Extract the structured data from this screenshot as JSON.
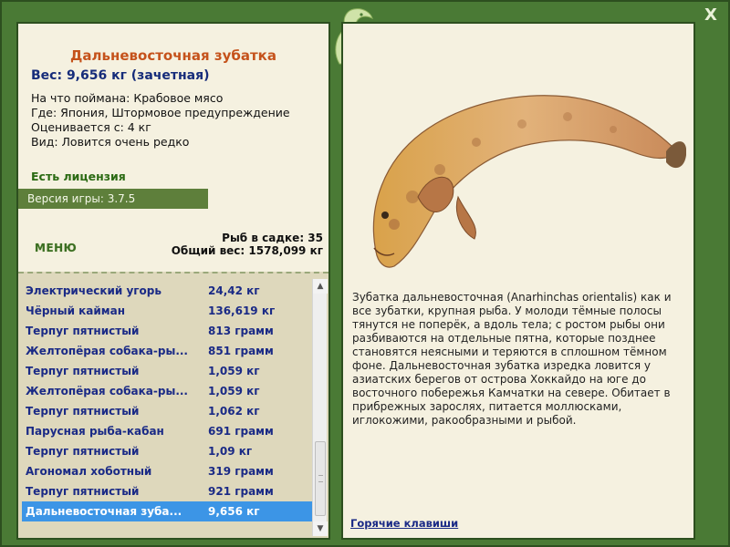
{
  "fish": {
    "title": "Дальневосточная зубатка",
    "weight_line": "Вес: 9,656 кг (зачетная)",
    "caught_on": "На что поймана: Крабовое мясо",
    "where": "Где: Япония, Штормовое предупреждение",
    "valued_from": "Оценивается с: 4 кг",
    "kind": "Вид: Ловится очень редко",
    "license": "Есть лицензия",
    "description": "Зубатка дальневосточная (Anarhinchas orientalis) как и все зубатки, крупная рыба. У молоди тёмные полосы тянутся не поперёк, а вдоль тела; с ростом рыбы они разбиваются на отдельные пятна, которые позднее становятся неясными и теряются в сплошном тёмном фоне. Дальневосточная зубатка изредка ловится у азиатских берегов от острова Хоккайдо на юге до восточного побережья Камчатки на севере. Обитает в прибрежных зарослях, питается моллюсками, иглокожими, ракообразными и рыбой."
  },
  "version": "Версия игры: 3.7.5",
  "menu_label": "МЕНЮ",
  "stats": {
    "fish_count": "Рыб в садке: 35",
    "total_weight": "Общий вес: 1578,099 кг"
  },
  "list": [
    {
      "name": "Электрический угорь",
      "weight": "24,42 кг"
    },
    {
      "name": "Чёрный кайман",
      "weight": "136,619 кг"
    },
    {
      "name": "Терпуг пятнистый",
      "weight": "813 грамм"
    },
    {
      "name": "Желтопёрая собака-ры...",
      "weight": "851 грамм"
    },
    {
      "name": "Терпуг пятнистый",
      "weight": "1,059 кг"
    },
    {
      "name": "Желтопёрая собака-ры...",
      "weight": "1,059 кг"
    },
    {
      "name": "Терпуг пятнистый",
      "weight": "1,062 кг"
    },
    {
      "name": "Парусная рыба-кабан",
      "weight": "691 грамм"
    },
    {
      "name": "Терпуг пятнистый",
      "weight": "1,09 кг"
    },
    {
      "name": "Агономал хоботный",
      "weight": "319 грамм"
    },
    {
      "name": "Терпуг пятнистый",
      "weight": "921 грамм"
    },
    {
      "name": "Дальневосточная зуба...",
      "weight": "9,656 кг",
      "selected": true
    }
  ],
  "hotkeys_label": "Горячие клавиши",
  "close_label": "X",
  "icons": {
    "close": "close-icon",
    "logo": "fish-logo-icon",
    "scroll_up": "scroll-up-icon",
    "scroll_down": "scroll-down-icon"
  },
  "colors": {
    "frame": "#4a7a35",
    "panel": "#f5f1e0",
    "title": "#c5521b",
    "weight": "#162c7a",
    "license": "#2a6a12",
    "selected": "#3c95e6"
  }
}
